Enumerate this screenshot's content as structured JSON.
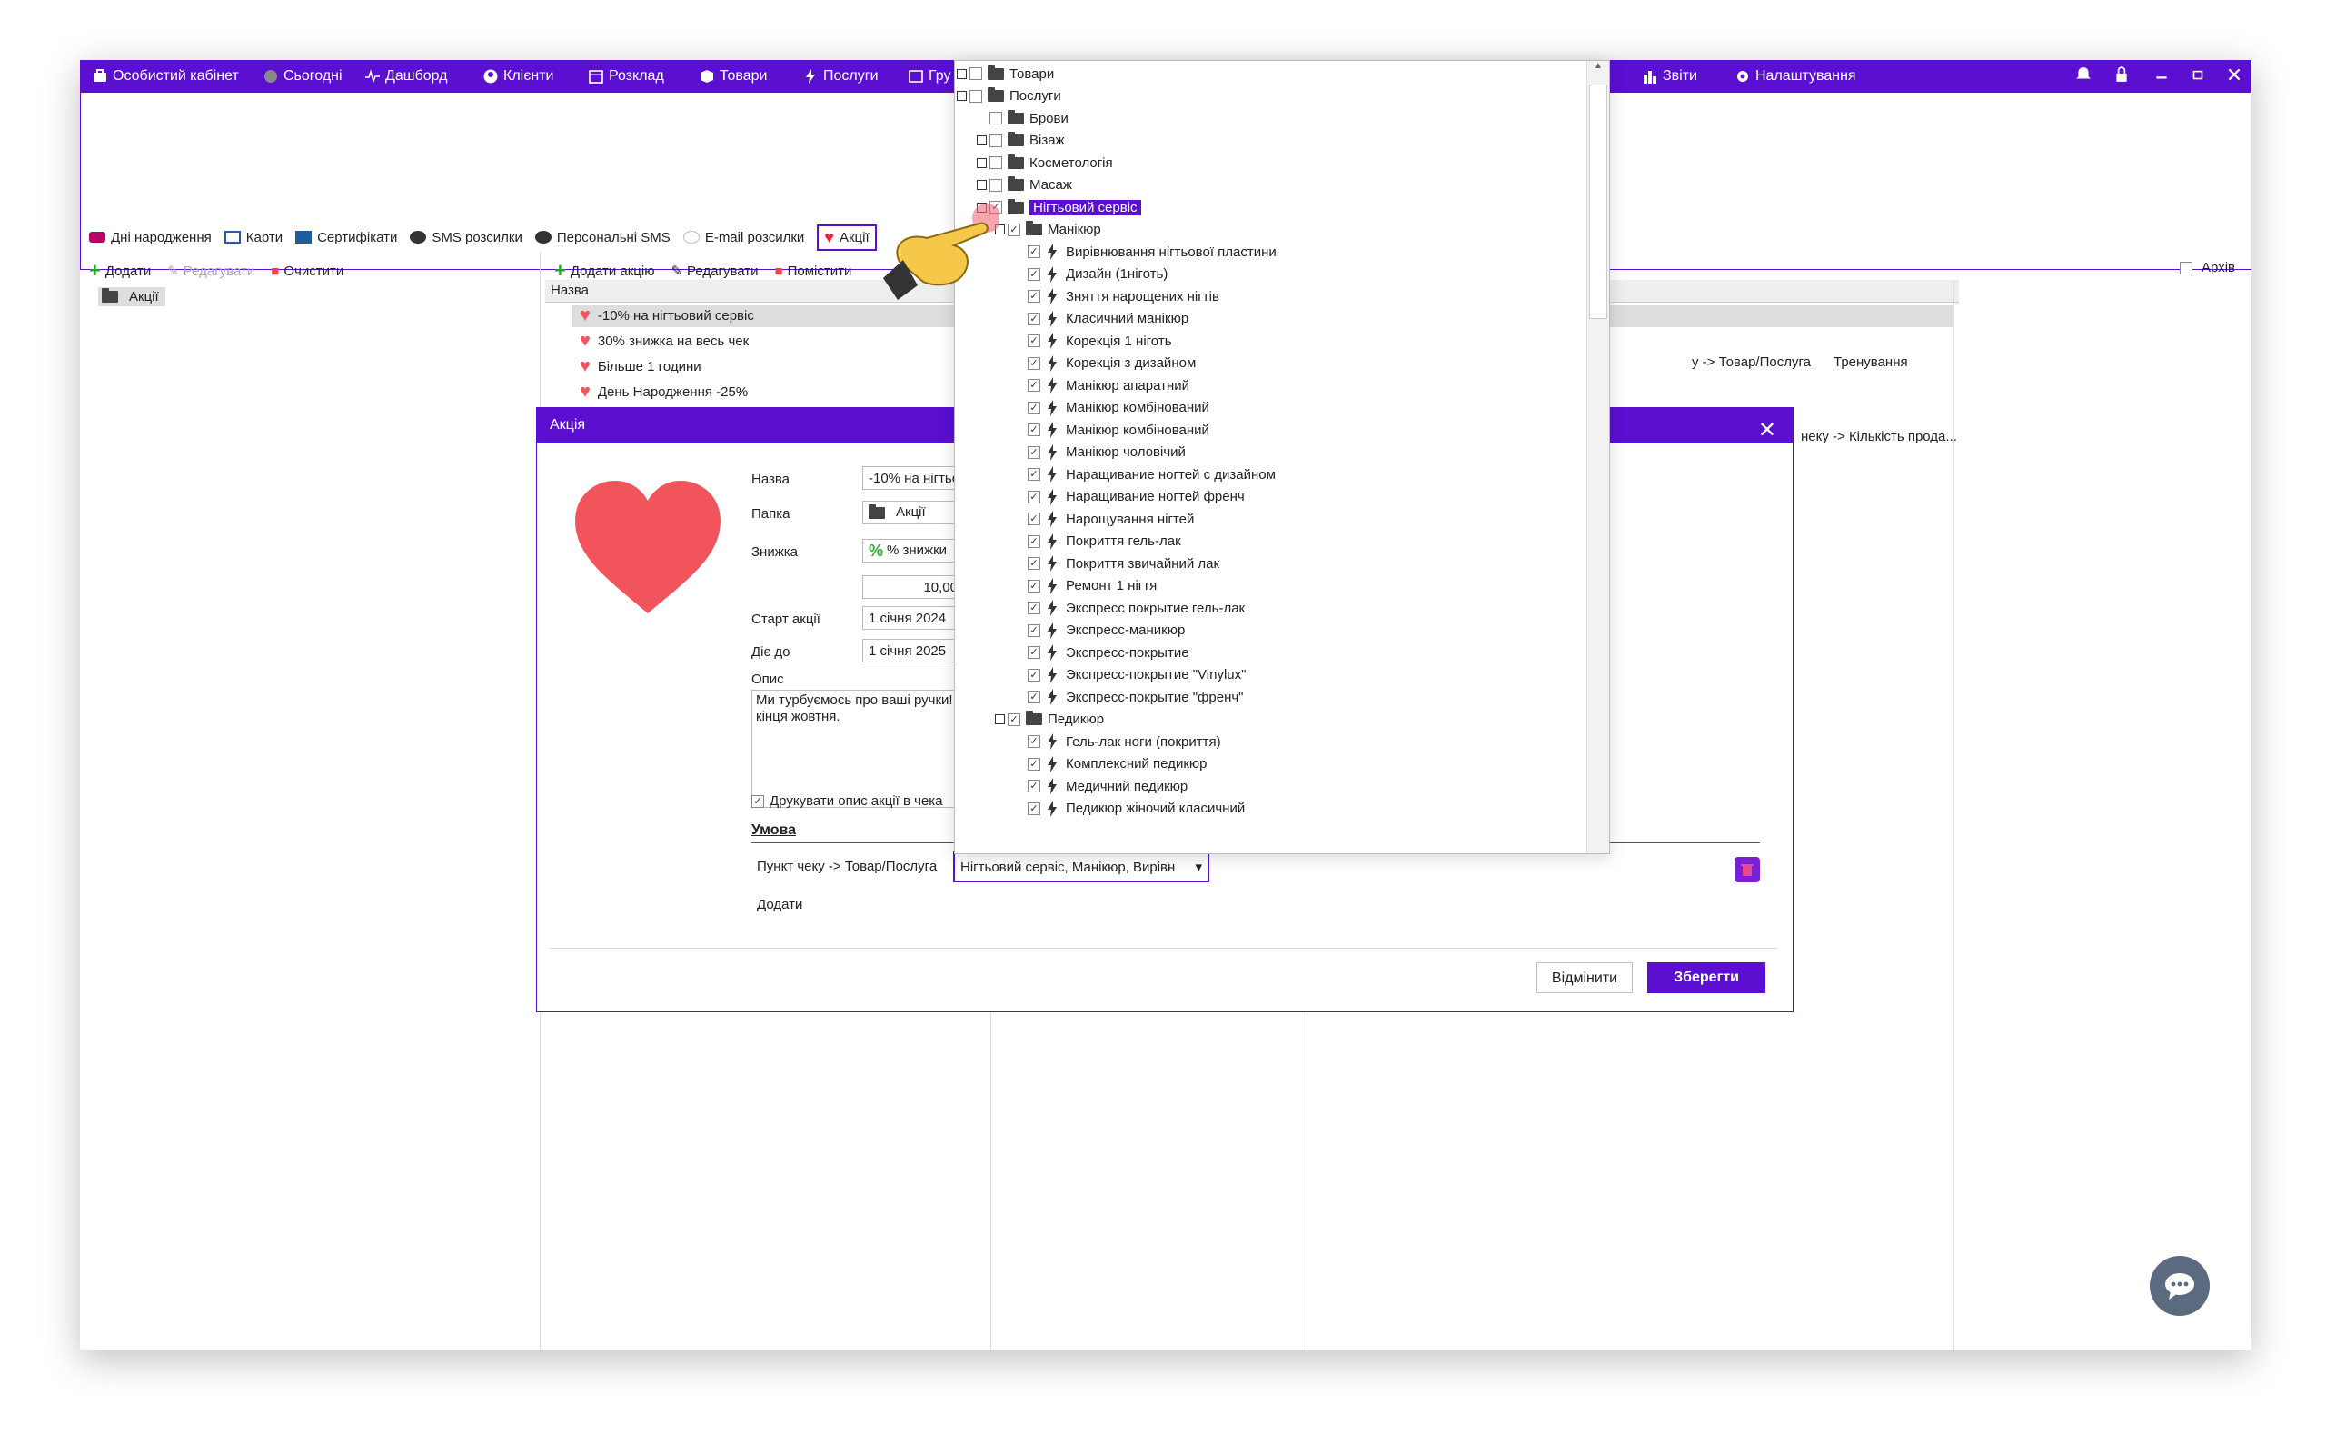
{
  "nav": {
    "items": [
      "Особистий кабінет",
      "Сьогодні",
      "Дашборд",
      "Клієнти",
      "Розклад",
      "Товари",
      "Послуги",
      "Гру"
    ],
    "right_items": [
      "Звіти",
      "Налаштування"
    ]
  },
  "subtabs": [
    "Дні народження",
    "Карти",
    "Сертифікати",
    "SMS розсилки",
    "Персональні SMS",
    "E-mail розсилки",
    "Акції"
  ],
  "left": {
    "toolbar": {
      "add": "Додати",
      "edit": "Редагувати",
      "clear": "Очистити"
    },
    "folder": "Акції"
  },
  "mid": {
    "toolbar": {
      "add": "Додати акцію",
      "edit": "Редагувати",
      "move": "Помістити"
    },
    "header": "Назва",
    "archive": "Архів",
    "rows": [
      "-10% на нігтьовий сервіс",
      "30% знижка на весь чек",
      "Більше 1 години",
      "День Народження -25%"
    ],
    "right_text_1": "у -> Товар/Послуга",
    "right_text_2": "Тренування",
    "right_text_3": "неку -> Кількість прода..."
  },
  "dialog": {
    "title": "Акція",
    "labels": {
      "name": "Назва",
      "folder": "Папка",
      "discount": "Знижка",
      "start": "Старт акції",
      "until": "Діє до",
      "desc": "Опис",
      "print": "Друкувати опис акції в чека",
      "condition": "Умова",
      "cond_item": "Пункт чеку -> Товар/Послуга",
      "add": "Додати"
    },
    "values": {
      "name": "-10% на нігтьо",
      "folder": "Акції",
      "discount_type": "% знижки",
      "discount_val": "10,00",
      "start": "1 січня 2024",
      "until": "1 січня 2025",
      "desc": "Ми турбуємось про ваші ручки! кінця жовтня."
    },
    "combo": "Нігтьовий сервіс, Манікюр, Вирівн",
    "cancel": "Відмінити",
    "save": "Зберегти"
  },
  "dropdown": {
    "top": [
      "Товари",
      "Послуги"
    ],
    "services": [
      "Брови",
      "Візаж",
      "Косметологія",
      "Масаж",
      "Нігтьовий сервіс"
    ],
    "manicure_folder": "Манікюр",
    "manicure": [
      "Вирівнювання нігтьової пластини",
      "Дизайн (1ніготь)",
      "Зняття нарощених нігтів",
      "Класичний манікюр",
      "Корекція 1 ніготь",
      "Корекція з дизайном",
      "Манікюр апаратний",
      "Манікюр комбінований",
      "Манікюр комбінований",
      "Манікюр чоловічий",
      "Наращивание ногтей с дизайном",
      "Наращивание ногтей френч",
      "Нарощування нігтей",
      "Покриття гель-лак",
      "Покриття звичайний лак",
      "Ремонт 1 нігтя",
      "Экспресс покрытие гель-лак",
      "Экспресс-маникюр",
      "Экспресс-покрытие",
      "Экспресс-покрытие \"Vinylux\"",
      "Экспресс-покрытие \"френч\""
    ],
    "pedicure_folder": "Педикюр",
    "pedicure": [
      "Гель-лак ноги (покриття)",
      "Комплексний педикюр",
      "Медичний педикюр",
      "Педикюр жіночий класичний"
    ]
  },
  "colors": {
    "accent": "#5a0fd1",
    "heart": "#f2545b",
    "delete": "#7a1fd6"
  }
}
